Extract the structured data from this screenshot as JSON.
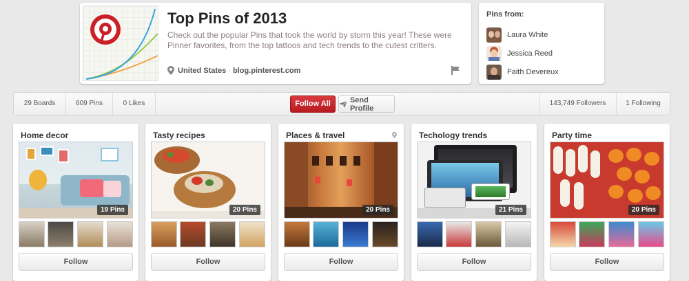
{
  "profile": {
    "title": "Top Pins of 2013",
    "description": "Check out the popular Pins that took the world by storm this year! These were Pinner favorites, from the top tattoos and tech trends to the cutest critters.",
    "location": "United States",
    "separator": "·",
    "website": "blog.pinterest.com",
    "brand_color": "#cb2027"
  },
  "pins_from": {
    "title": "Pins from:",
    "pinners": [
      {
        "name": "Laura White"
      },
      {
        "name": "Jessica Reed"
      },
      {
        "name": "Faith Devereux"
      }
    ]
  },
  "stats": {
    "boards": "29 Boards",
    "pins": "609 Pins",
    "likes": "0 Likes",
    "followers": "143,749 Followers",
    "following": "1 Following",
    "follow_all": "Follow All",
    "send_profile": "Send Profile"
  },
  "boards": [
    {
      "title": "Home decor",
      "pin_count": "19 Pins",
      "follow": "Follow"
    },
    {
      "title": "Tasty recipes",
      "pin_count": "20 Pins",
      "follow": "Follow"
    },
    {
      "title": "Places & travel",
      "pin_count": "20 Pins",
      "follow": "Follow"
    },
    {
      "title": "Techology trends",
      "pin_count": "21 Pins",
      "follow": "Follow"
    },
    {
      "title": "Party time",
      "pin_count": "20 Pins",
      "follow": "Follow"
    }
  ]
}
